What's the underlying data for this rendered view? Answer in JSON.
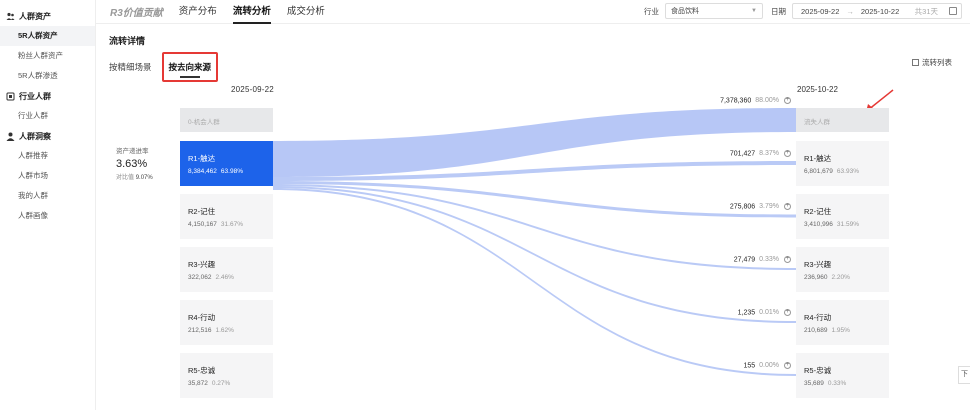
{
  "sidebar": {
    "groups": [
      {
        "title": "人群资产",
        "icon": "users-icon",
        "items": [
          "5R人群资产",
          "粉丝人群资产",
          "5R人群渗透"
        ]
      },
      {
        "title": "行业人群",
        "icon": "industry-icon",
        "items": [
          "行业人群"
        ]
      },
      {
        "title": "人群洞察",
        "icon": "person-icon",
        "items": [
          "人群推荐",
          "人群市场",
          "我的人群",
          "人群画像"
        ]
      }
    ],
    "active_item": "5R人群资产"
  },
  "topbar": {
    "brand": "R3价值贡献",
    "tabs": [
      "资产分布",
      "流转分析",
      "成交分析"
    ],
    "active_tab": "流转分析",
    "industry_label": "行业",
    "industry_value": "食品饮料",
    "date_label": "日期",
    "date_start": "2025-09-22",
    "date_arrow": "→",
    "date_end": "2025-10-22",
    "date_days": "共31天"
  },
  "section": {
    "title": "流转详情",
    "subtabs": [
      "按精细场景",
      "按去向来源"
    ],
    "active_subtab": "按去向来源",
    "flow_list_label": "流转列表"
  },
  "left_date": "2025-09-22",
  "right_date": "2025-10-22",
  "metric": {
    "label": "资产递进率",
    "value": "3.63%",
    "compare_label": "对比值",
    "compare_value": "9.07%"
  },
  "left_nodes": [
    {
      "name": "0-机会人群",
      "num": "",
      "pct": "",
      "style": "ghost"
    },
    {
      "name": "R1-触达",
      "num": "8,384,462",
      "pct": "63.98%",
      "style": "selected"
    },
    {
      "name": "R2-记住",
      "num": "4,150,167",
      "pct": "31.67%",
      "style": "normal"
    },
    {
      "name": "R3-兴趣",
      "num": "322,062",
      "pct": "2.46%",
      "style": "normal"
    },
    {
      "name": "R4-行动",
      "num": "212,516",
      "pct": "1.62%",
      "style": "normal"
    },
    {
      "name": "R5-忠诚",
      "num": "35,872",
      "pct": "0.27%",
      "style": "normal"
    }
  ],
  "right_nodes": [
    {
      "name": "流失人群",
      "num": "",
      "pct": "",
      "style": "ghost"
    },
    {
      "name": "R1-触达",
      "num": "6,801,679",
      "pct": "63.93%",
      "style": "normal"
    },
    {
      "name": "R2-记住",
      "num": "3,410,996",
      "pct": "31.59%",
      "style": "normal"
    },
    {
      "name": "R3-兴趣",
      "num": "236,960",
      "pct": "2.20%",
      "style": "normal"
    },
    {
      "name": "R4-行动",
      "num": "210,689",
      "pct": "1.95%",
      "style": "normal"
    },
    {
      "name": "R5-忠诚",
      "num": "35,689",
      "pct": "0.33%",
      "style": "normal"
    }
  ],
  "flows": [
    {
      "to": "流失人群",
      "value": "7,378,360",
      "pct": "88.00%"
    },
    {
      "to": "R1-触达",
      "value": "701,427",
      "pct": "8.37%"
    },
    {
      "to": "R2-记住",
      "value": "275,806",
      "pct": "3.79%"
    },
    {
      "to": "R3-兴趣",
      "value": "27,479",
      "pct": "0.33%"
    },
    {
      "to": "R4-行动",
      "value": "1,235",
      "pct": "0.01%"
    },
    {
      "to": "R5-忠诚",
      "value": "155",
      "pct": "0.00%"
    }
  ],
  "colors": {
    "accent": "#1d63ea",
    "flow": "#b3c4f5",
    "highlight": "#e53935"
  },
  "float_button": "下"
}
